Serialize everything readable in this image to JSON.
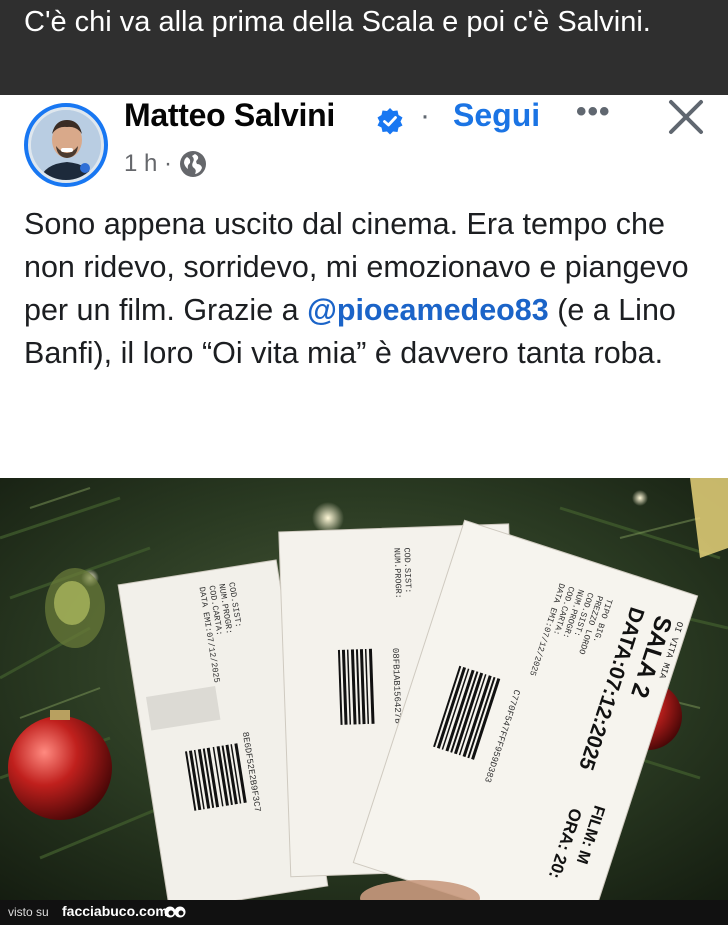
{
  "meme": {
    "caption": "C'è chi va alla prima della Scala e poi c'è Salvini."
  },
  "post": {
    "author": "Matteo Salvini",
    "separator": "·",
    "follow_label": "Segui",
    "more_label": "•••",
    "time": "1 h ·",
    "body_before": "Sono appena uscito dal cinema. Era tempo che non ridevo, sorridevo, mi emozionavo e piangevo per un film. Grazie a ",
    "mention": "@pioeamedeo83",
    "body_after": " (e a Lino Banfi), il loro “Oi vita mia” è davvero tanta roba."
  },
  "tickets": {
    "sala": "SALA 2",
    "data": "DATA:07:12:2025",
    "ora": "ORA: 20:",
    "film": "FILM: M",
    "vita_mia": "OI VITA MIA",
    "tipo": "TIPO BIG.",
    "prezzo_lordo": "PREZZO LORDO",
    "cod_sist": "COD.SIST:",
    "num_progr": "NUM.PROGR:",
    "cod_carta": "COD.CARTA:",
    "data_emi": "DATA EMI:07/12/2025",
    "code1": "8E6DF52E2B9F3C7",
    "code2": "08FB1AB156427B",
    "code3": "C770F547FFF959D383"
  },
  "footer": {
    "visto_su": "visto su",
    "site": "facciabuco.com"
  },
  "colors": {
    "accent": "#1b74e4",
    "mention": "#1b64c8",
    "caption_bg": "#2f2f2f"
  }
}
